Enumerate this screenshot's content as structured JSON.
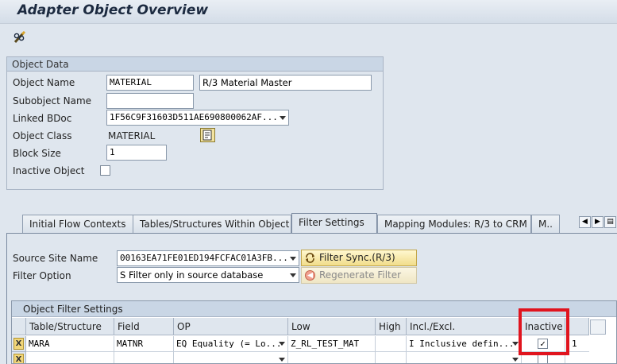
{
  "window": {
    "title": "Adapter Object Overview"
  },
  "toolbar": {
    "edit_icon": "pencil-glasses-icon"
  },
  "object_data": {
    "header": "Object Data",
    "fields": {
      "object_name": {
        "label": "Object Name",
        "value": "MATERIAL",
        "description": "R/3 Material Master"
      },
      "subobject_name": {
        "label": "Subobject Name",
        "value": ""
      },
      "linked_bdoc": {
        "label": "Linked BDoc",
        "value": "1F56C9F31603D511AE690800062AF..."
      },
      "object_class": {
        "label": "Object Class",
        "value": "MATERIAL"
      },
      "block_size": {
        "label": "Block Size",
        "value": "1"
      },
      "inactive_object": {
        "label": "Inactive Object",
        "checked": false
      }
    }
  },
  "tabs": [
    {
      "label": "Initial Flow Contexts",
      "active": false
    },
    {
      "label": "Tables/Structures Within Object",
      "active": false
    },
    {
      "label": "Filter Settings",
      "active": true
    },
    {
      "label": "Mapping Modules: R/3 to CRM",
      "active": false
    },
    {
      "label": "M..",
      "active": false
    }
  ],
  "filter_settings": {
    "source_site": {
      "label": "Source Site Name",
      "value": "00163EA71FE01ED194FCFAC01A3FB..."
    },
    "filter_option": {
      "label": "Filter Option",
      "value": "S Filter only in source database"
    },
    "filter_sync_button": "Filter Sync.(R/3)",
    "regenerate_button": "Regenerate Filter"
  },
  "object_filter_settings": {
    "title": "Object Filter Settings",
    "columns": [
      "Table/Structure",
      "Field",
      "OP",
      "Low",
      "High",
      "Incl./Excl.",
      "Inactive"
    ],
    "rows": [
      {
        "table": "MARA",
        "field": "MATNR",
        "op": "EQ Equality (= Lo...",
        "low": "Z_RL_TEST_MAT",
        "high": "",
        "incl": "I Inclusive defin...",
        "inactive": true,
        "extra": "1"
      },
      {
        "table": "",
        "field": "",
        "op": "",
        "low": "",
        "high": "",
        "incl": "",
        "inactive": false,
        "extra": ""
      }
    ]
  },
  "colors": {
    "highlight_box": "#e0141e",
    "button_yellow": "#f1dd8a"
  }
}
